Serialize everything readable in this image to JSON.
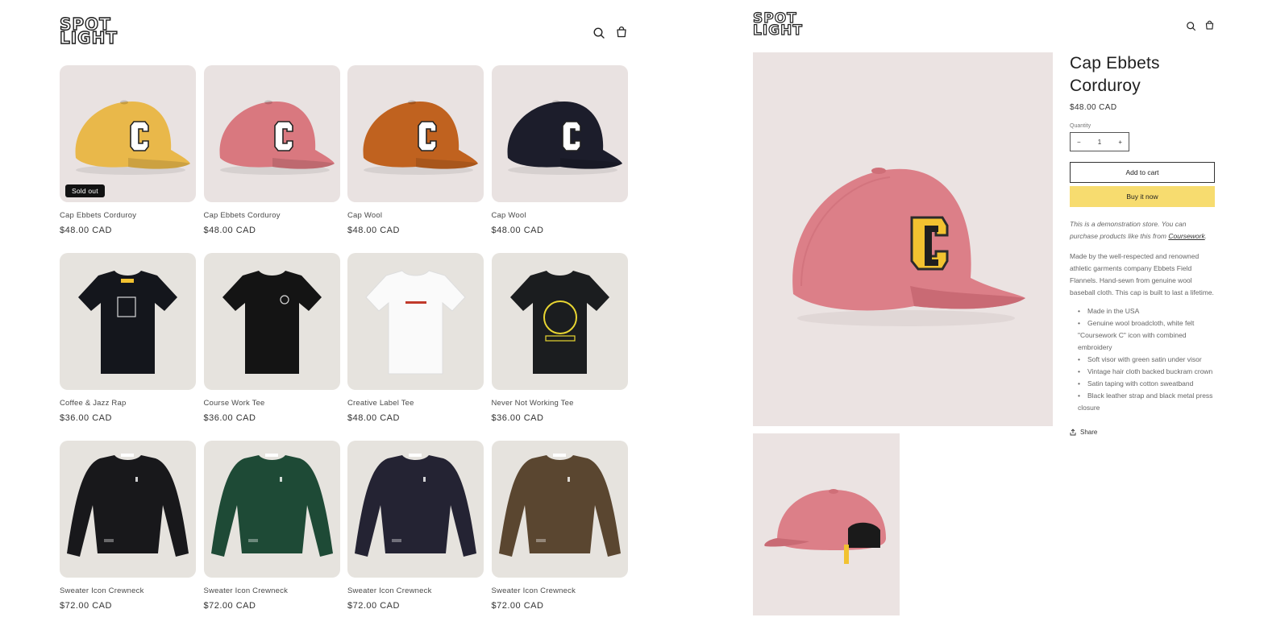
{
  "left": {
    "logo": {
      "line1": "SPOT",
      "line2": "LIGHT"
    },
    "header_icons": [
      "search-icon",
      "cart-icon"
    ],
    "products": [
      {
        "title": "Cap Ebbets Corduroy",
        "price": "$48.00 CAD",
        "kind": "cap",
        "color": "#e9b84a",
        "badge": "Sold out"
      },
      {
        "title": "Cap Ebbets Corduroy",
        "price": "$48.00 CAD",
        "kind": "cap",
        "color": "#d9787f"
      },
      {
        "title": "Cap Wool",
        "price": "$48.00 CAD",
        "kind": "cap",
        "color": "#c0621f"
      },
      {
        "title": "Cap Wool",
        "price": "$48.00 CAD",
        "kind": "cap",
        "color": "#1c1d2b"
      },
      {
        "title": "Coffee & Jazz Rap",
        "price": "$36.00 CAD",
        "kind": "tee",
        "color": "#14161c"
      },
      {
        "title": "Course Work Tee",
        "price": "$36.00 CAD",
        "kind": "tee",
        "color": "#141414"
      },
      {
        "title": "Creative Label Tee",
        "price": "$48.00 CAD",
        "kind": "tee",
        "color": "#fafafa"
      },
      {
        "title": "Never Not Working Tee",
        "price": "$36.00 CAD",
        "kind": "tee",
        "color": "#1b1d1f"
      },
      {
        "title": "Sweater Icon Crewneck",
        "price": "$72.00 CAD",
        "kind": "sweater",
        "color": "#18181b"
      },
      {
        "title": "Sweater Icon Crewneck",
        "price": "$72.00 CAD",
        "kind": "sweater",
        "color": "#1e4a36"
      },
      {
        "title": "Sweater Icon Crewneck",
        "price": "$72.00 CAD",
        "kind": "sweater",
        "color": "#242333"
      },
      {
        "title": "Sweater Icon Crewneck",
        "price": "$72.00 CAD",
        "kind": "sweater",
        "color": "#5a4630"
      }
    ]
  },
  "right": {
    "logo": {
      "line1": "SPOT",
      "line2": "LIGHT"
    },
    "header_icons": [
      "search-icon",
      "cart-icon"
    ],
    "product": {
      "title": "Cap Ebbets Corduroy",
      "price": "$48.00 CAD",
      "quantity_label": "Quantity",
      "quantity_value": "1",
      "minus": "−",
      "plus": "+",
      "add_to_cart": "Add to cart",
      "buy_now": "Buy it now",
      "demo_text": "This is a demonstration store. You can purchase products like this from ",
      "demo_link": "Coursework",
      "demo_end": ".",
      "description": "Made by the well-respected and renowned athletic garments company Ebbets Field Flannels. Hand-sewn from genuine wool baseball cloth. This cap is built to last a lifetime.",
      "bullets": [
        "Made in the USA",
        "Genuine wool broadcloth, white felt \"Coursework C\" icon  with combined embroidery",
        "Soft visor with green satin under visor",
        "Vintage hair cloth backed buckram crown",
        "Satin taping with cotton sweatband",
        "Black leather strap and black metal press closure"
      ],
      "share": "Share",
      "cap_color": "#dc7f88"
    }
  },
  "colors": {
    "buy_button": "#f7dc6f",
    "badge": "#121212",
    "card_bg": "#e9e2e1"
  }
}
